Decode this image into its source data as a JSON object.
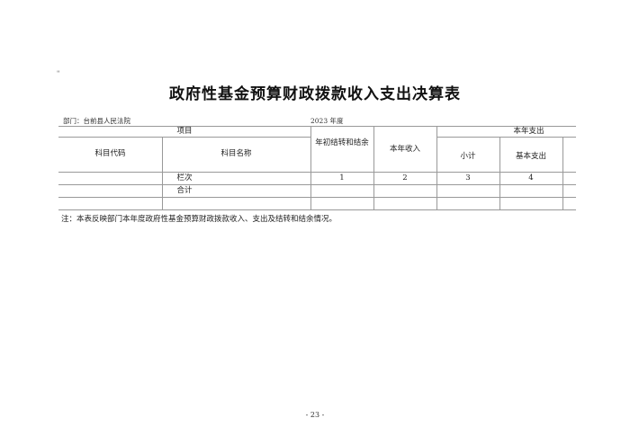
{
  "mark": "\"",
  "title": "政府性基金预算财政拨款收入支出决算表",
  "department": "部门：台前县人民法院",
  "year": "2023 年度",
  "table": {
    "group_project": "项目",
    "group_expense": "本年支出",
    "col_code": "科目代码",
    "col_name": "科目名称",
    "col_carry_begin": "年初结转和结余",
    "col_income": "本年收入",
    "col_subtotal": "小计",
    "col_basic": "基本支出",
    "row_index_label": "栏次",
    "row_index_values": [
      "1",
      "2",
      "3",
      "4"
    ],
    "row_total_label": "合计"
  },
  "note": "注：本表反映部门本年度政府性基金预算财政拨款收入、支出及结转和结余情况。",
  "page_number": "- 23 -"
}
